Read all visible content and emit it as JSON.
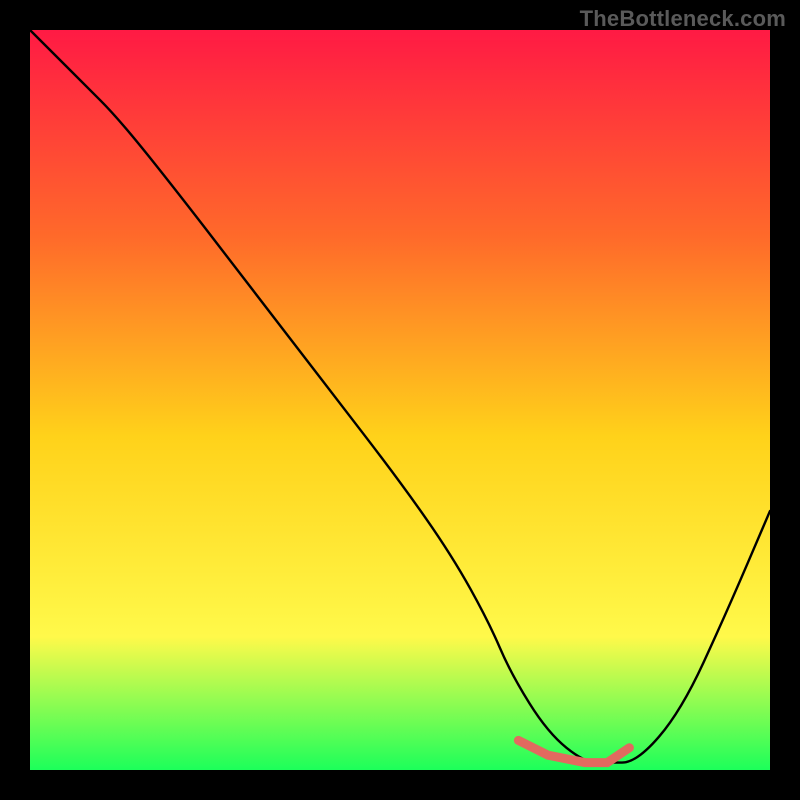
{
  "watermark": "TheBottleneck.com",
  "colors": {
    "background": "#000000",
    "gradient_top": "#ff1a44",
    "gradient_mid_upper": "#ff6a2a",
    "gradient_mid": "#ffd21a",
    "gradient_mid_lower": "#fff94a",
    "gradient_bottom": "#1cff5a",
    "curve": "#000000",
    "highlight": "#e26a5f"
  },
  "chart_data": {
    "type": "line",
    "title": "",
    "xlabel": "",
    "ylabel": "",
    "xlim": [
      0,
      100
    ],
    "ylim": [
      0,
      100
    ],
    "series": [
      {
        "name": "bottleneck-curve",
        "x": [
          0,
          3,
          7,
          12,
          20,
          30,
          40,
          50,
          57,
          62,
          65,
          70,
          75,
          78,
          82,
          88,
          94,
          100
        ],
        "y": [
          100,
          97,
          93,
          88,
          78,
          65,
          52,
          39,
          29,
          20,
          13,
          5,
          1,
          1,
          1,
          8,
          21,
          35
        ]
      }
    ],
    "highlight_segment": {
      "name": "optimal-range",
      "x": [
        66,
        70,
        75,
        78,
        81
      ],
      "y": [
        4,
        2,
        1,
        1,
        3
      ]
    }
  }
}
